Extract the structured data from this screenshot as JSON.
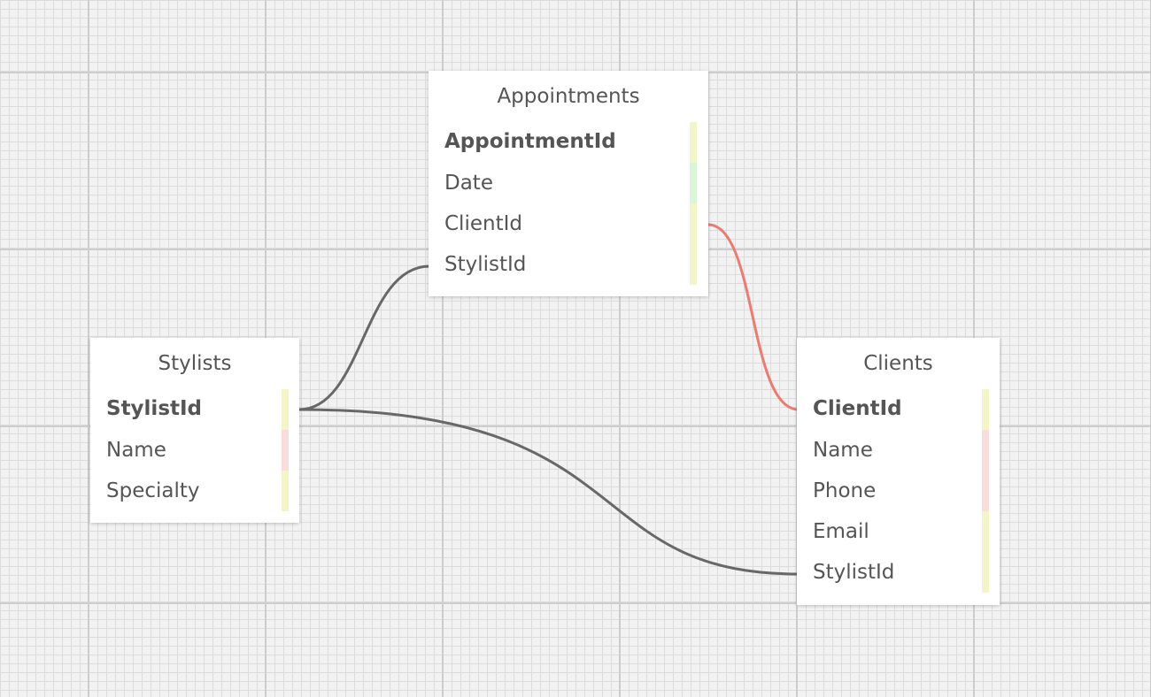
{
  "diagram": {
    "tables": [
      {
        "id": "appointments",
        "title": "Appointments",
        "fields": [
          {
            "name": "AppointmentId",
            "primary": true,
            "color": "#f3f4c8"
          },
          {
            "name": "Date",
            "primary": false,
            "color": "#d9f7d6"
          },
          {
            "name": "ClientId",
            "primary": false,
            "color": "#f3f4c8"
          },
          {
            "name": "StylistId",
            "primary": false,
            "color": "#f3f4c8"
          }
        ]
      },
      {
        "id": "stylists",
        "title": "Stylists",
        "fields": [
          {
            "name": "StylistId",
            "primary": true,
            "color": "#f3f4c8"
          },
          {
            "name": "Name",
            "primary": false,
            "color": "#f9dcdc"
          },
          {
            "name": "Specialty",
            "primary": false,
            "color": "#f3f4c8"
          }
        ]
      },
      {
        "id": "clients",
        "title": "Clients",
        "fields": [
          {
            "name": "ClientId",
            "primary": true,
            "color": "#f3f4c8"
          },
          {
            "name": "Name",
            "primary": false,
            "color": "#f9dcdc"
          },
          {
            "name": "Phone",
            "primary": false,
            "color": "#f9dcdc"
          },
          {
            "name": "Email",
            "primary": false,
            "color": "#f3f4c8"
          },
          {
            "name": "StylistId",
            "primary": false,
            "color": "#f3f4c8"
          }
        ]
      }
    ],
    "relations": [
      {
        "from": "appointments.ClientId",
        "to": "clients.ClientId",
        "color": "#ea7b72"
      },
      {
        "from": "stylists.StylistId",
        "to": "appointments.StylistId",
        "color": "#686868"
      },
      {
        "from": "stylists.StylistId",
        "to": "clients.StylistId",
        "color": "#686868"
      }
    ]
  }
}
